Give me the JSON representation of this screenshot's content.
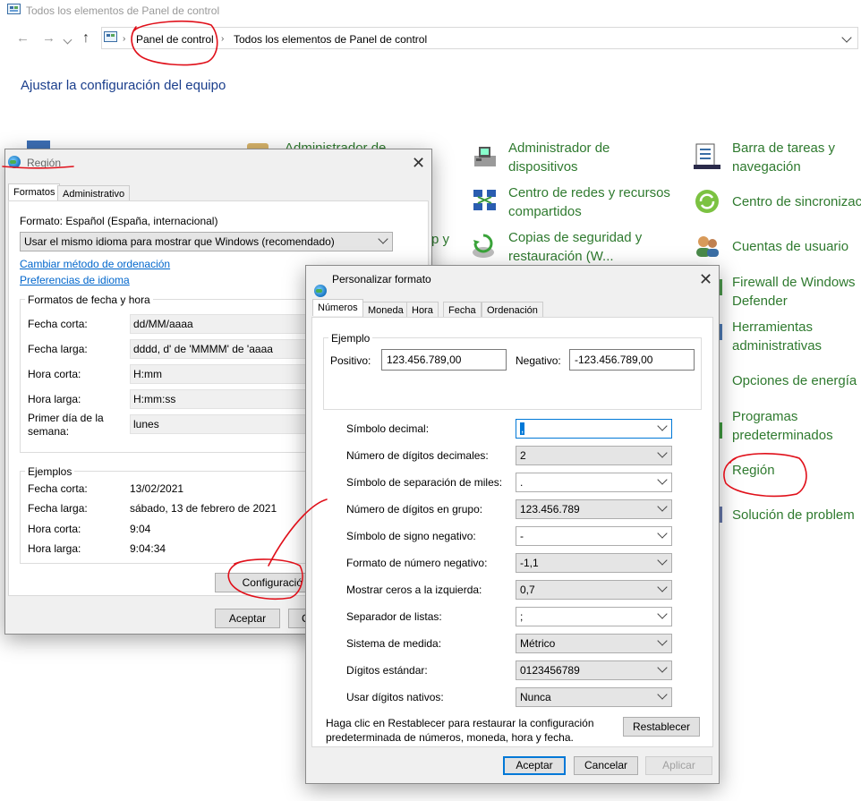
{
  "control_panel": {
    "window_title": "Todos los elementos de Panel de control",
    "breadcrumb": [
      "Panel de control",
      "Todos los elementos de Panel de control"
    ],
    "heading": "Ajustar la configuración del equipo",
    "partial_items": {
      "col2_top": "Administrador de",
      "col2_mid": "p y"
    },
    "col3": [
      "Administrador de dispositivos",
      "Centro de redes y recursos compartidos",
      "Copias de seguridad y restauración (W..."
    ],
    "col3_lines": [
      [
        "Administrador de",
        "dispositivos"
      ],
      [
        "Centro de redes y recursos",
        "compartidos"
      ],
      [
        "Copias de seguridad y",
        "restauración (W..."
      ]
    ],
    "col4_lines": [
      [
        "Barra de tareas y",
        "navegación"
      ],
      [
        "Centro de sincronizac"
      ],
      [
        "Cuentas de usuario"
      ],
      [
        "Firewall de Windows",
        "Defender"
      ],
      [
        "Herramientas",
        "administrativas"
      ],
      [
        "Opciones de energía"
      ],
      [
        "Programas",
        "predeterminados"
      ],
      [
        "Región"
      ],
      [
        "Solución de problem"
      ]
    ]
  },
  "region_dialog": {
    "title": "Región",
    "tabs": [
      "Formatos",
      "Administrativo"
    ],
    "format_label": "Formato: Español (España, internacional)",
    "format_select": "Usar el mismo idioma para mostrar que Windows (recomendado)",
    "link_sort": "Cambiar método de ordenación",
    "link_lang": "Preferencias de idioma",
    "date_time_group": "Formatos de fecha y hora",
    "fields": [
      {
        "label": "Fecha corta:",
        "value": "dd/MM/aaaa"
      },
      {
        "label": "Fecha larga:",
        "value": "dddd, d' de 'MMMM' de 'aaaa"
      },
      {
        "label": "Hora corta:",
        "value": "H:mm"
      },
      {
        "label": "Hora larga:",
        "value": "H:mm:ss"
      },
      {
        "label": "Primer día de la semana:",
        "value": "lunes"
      }
    ],
    "first_day_label_lines": [
      "Primer día de la",
      "semana:"
    ],
    "examples_group": "Ejemplos",
    "examples": [
      {
        "label": "Fecha corta:",
        "value": "13/02/2021"
      },
      {
        "label": "Fecha larga:",
        "value": "sábado, 13 de febrero de 2021"
      },
      {
        "label": "Hora corta:",
        "value": "9:04"
      },
      {
        "label": "Hora larga:",
        "value": "9:04:34"
      }
    ],
    "config_button": "Configuració",
    "accept_button": "Aceptar",
    "cancel_partial": "C"
  },
  "custom_dialog": {
    "title": "Personalizar formato",
    "tabs": [
      "Números",
      "Moneda",
      "Hora",
      "Fecha",
      "Ordenación"
    ],
    "example_group": "Ejemplo",
    "positive_label": "Positivo:",
    "positive_value": "123.456.789,00",
    "negative_label": "Negativo:",
    "negative_value": "-123.456.789,00",
    "settings": [
      {
        "label": "Símbolo decimal:",
        "value": ",",
        "editable": true
      },
      {
        "label": "Número de dígitos decimales:",
        "value": "2",
        "editable": false
      },
      {
        "label": "Símbolo de separación de miles:",
        "value": ".",
        "editable": true
      },
      {
        "label": "Número de dígitos en grupo:",
        "value": "123.456.789",
        "editable": false
      },
      {
        "label": "Símbolo de signo negativo:",
        "value": "-",
        "editable": true
      },
      {
        "label": "Formato de número negativo:",
        "value": "-1,1",
        "editable": false
      },
      {
        "label": "Mostrar ceros a la izquierda:",
        "value": "0,7",
        "editable": false
      },
      {
        "label": "Separador de listas:",
        "value": ";",
        "editable": true
      },
      {
        "label": "Sistema de medida:",
        "value": "Métrico",
        "editable": false
      },
      {
        "label": "Dígitos estándar:",
        "value": "0123456789",
        "editable": false
      },
      {
        "label": "Usar dígitos nativos:",
        "value": "Nunca",
        "editable": false
      }
    ],
    "reset_text_lines": [
      "Haga clic en Restablecer para restaurar la configuración",
      "predeterminada de números, moneda, hora y fecha."
    ],
    "reset_button": "Restablecer",
    "accept_button": "Aceptar",
    "cancel_button": "Cancelar",
    "apply_button": "Aplicar"
  },
  "annotation_color": "#e0101a"
}
